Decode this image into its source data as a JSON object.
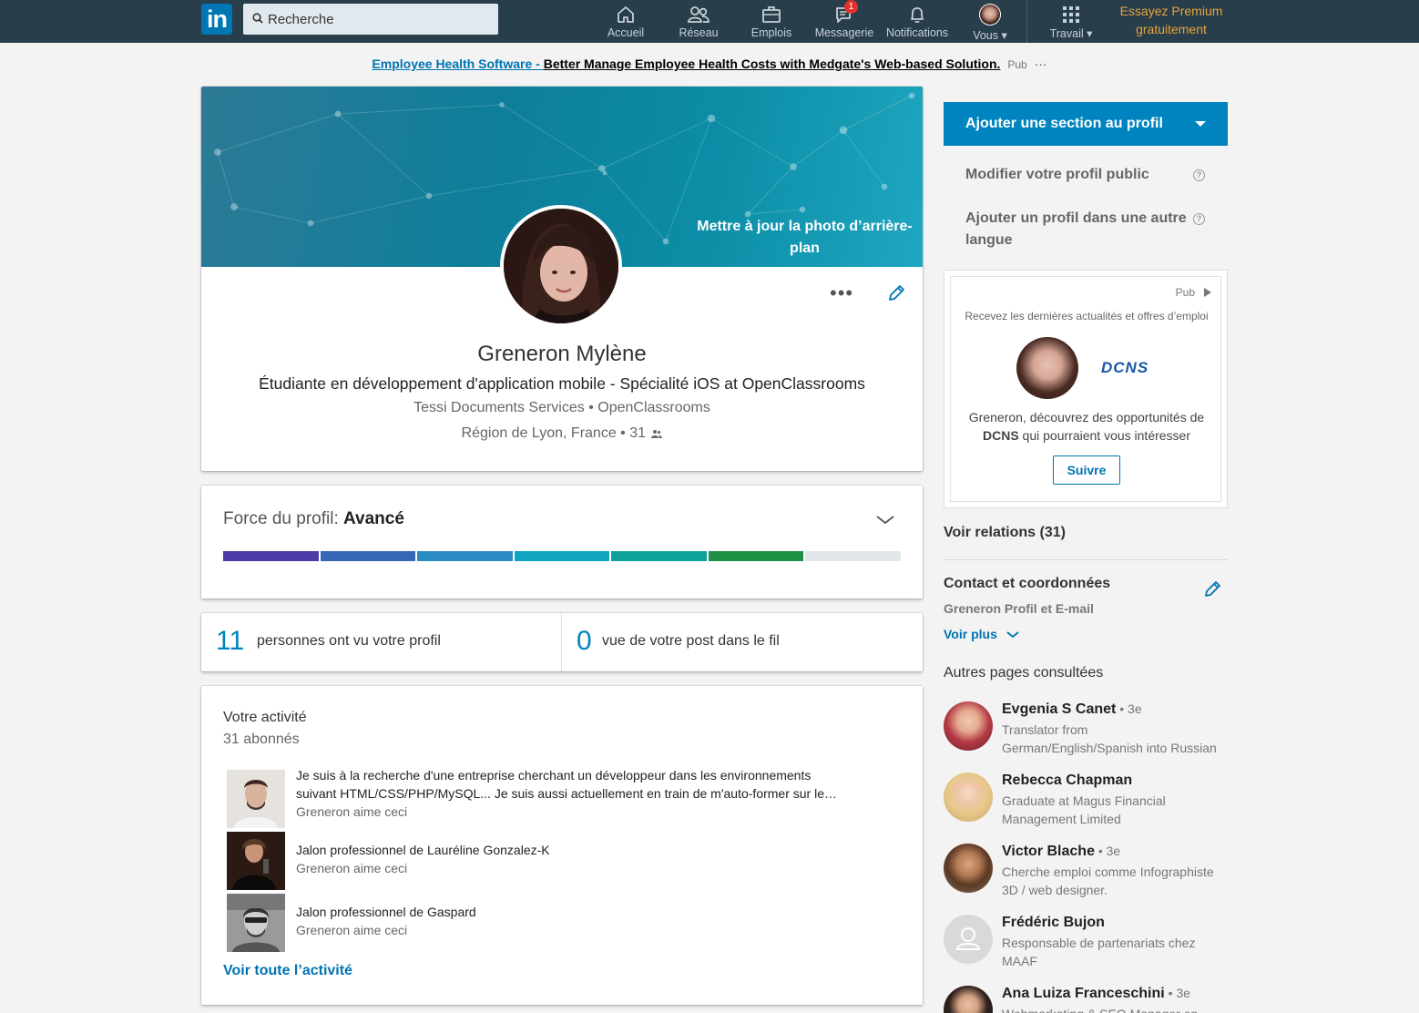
{
  "nav": {
    "logo": "in",
    "search_placeholder": "Recherche",
    "items": [
      {
        "label": "Accueil",
        "icon": "home-icon"
      },
      {
        "label": "Réseau",
        "icon": "network-icon"
      },
      {
        "label": "Emplois",
        "icon": "briefcase-icon"
      },
      {
        "label": "Messagerie",
        "icon": "messaging-icon",
        "badge": "1"
      },
      {
        "label": "Notifications",
        "icon": "bell-icon"
      },
      {
        "label": "Vous",
        "icon": "avatar"
      },
      {
        "label": "Travail",
        "icon": "grid-icon"
      }
    ],
    "premium": "Essayez Premium gratuitement"
  },
  "ad_banner": {
    "link": "Employee Health Software - ",
    "text": "Better Manage Employee Health Costs with Medgate's Web-based Solution.",
    "pub": "Pub",
    "more": "···"
  },
  "profile": {
    "banner_action": "Mettre à jour la photo d’arrière-plan",
    "more": "•••",
    "name": "Greneron Mylène",
    "headline": "Étudiante en développement d'application mobile - Spécialité iOS at OpenClassrooms",
    "companies": "Tessi Documents Services • OpenClassrooms",
    "location": "Région de Lyon, France • 31",
    "connections_icon": "people-icon"
  },
  "strength": {
    "label": "Force du profil: ",
    "level": "Avancé",
    "filled_segments": 6,
    "total_segments": 7,
    "colors": [
      "#4a3ba7",
      "#3866b7",
      "#2a8ac2",
      "#10a5be",
      "#0fa29a",
      "#1f9146",
      "#e1e7ea"
    ]
  },
  "stats": [
    {
      "number": "11",
      "text": "personnes ont vu votre profil"
    },
    {
      "number": "0",
      "text": "vue de votre post dans le fil"
    }
  ],
  "activity": {
    "title": "Votre activité",
    "followers": "31 abonnés",
    "items": [
      {
        "text": "Je suis à la recherche d'une entreprise cherchant un développeur dans les environnements suivant HTML/CSS/PHP/MySQL... Je suis aussi actuellement en train de m'auto-former sur le…",
        "meta": "Greneron aime ceci"
      },
      {
        "text": "Jalon professionnel de Lauréline Gonzalez-K",
        "meta": "Greneron aime ceci"
      },
      {
        "text": "Jalon professionnel de Gaspard",
        "meta": "Greneron aime ceci"
      }
    ],
    "see_all": "Voir toute l’activité"
  },
  "sidebar": {
    "add_section": "Ajouter une section au profil",
    "public_profile": "Modifier votre profil public",
    "other_language": "Ajouter un profil dans une autre langue",
    "help": "?",
    "ad": {
      "pub": "Pub",
      "intro": "Recevez les dernières actualités et offres d’emploi",
      "company": "DCNS",
      "message_prefix": "Greneron, découvrez des opportunités de ",
      "message_company": "DCNS",
      "message_suffix": " qui pourraient vous intéresser",
      "follow": "Suivre"
    },
    "relations": "Voir relations (31)",
    "contact": {
      "title": "Contact et coordonnées",
      "subtitle": "Greneron Profil et E-mail",
      "more": "Voir plus"
    },
    "other_pages_title": "Autres pages consultées",
    "people": [
      {
        "name": "Evgenia S Canet",
        "degree": " • 3e",
        "job": "Translator from German/English/Spanish into Russian"
      },
      {
        "name": "Rebecca Chapman",
        "degree": "",
        "job": "Graduate at Magus Financial Management Limited"
      },
      {
        "name": "Victor Blache",
        "degree": " • 3e",
        "job": "Cherche emploi comme Infographiste 3D / web designer."
      },
      {
        "name": "Frédéric Bujon",
        "degree": "",
        "job": "Responsable de partenariats chez MAAF"
      },
      {
        "name": "Ana Luiza Franceschini",
        "degree": " • 3e",
        "job": "Webmarketing & SEO Manager en"
      }
    ]
  }
}
